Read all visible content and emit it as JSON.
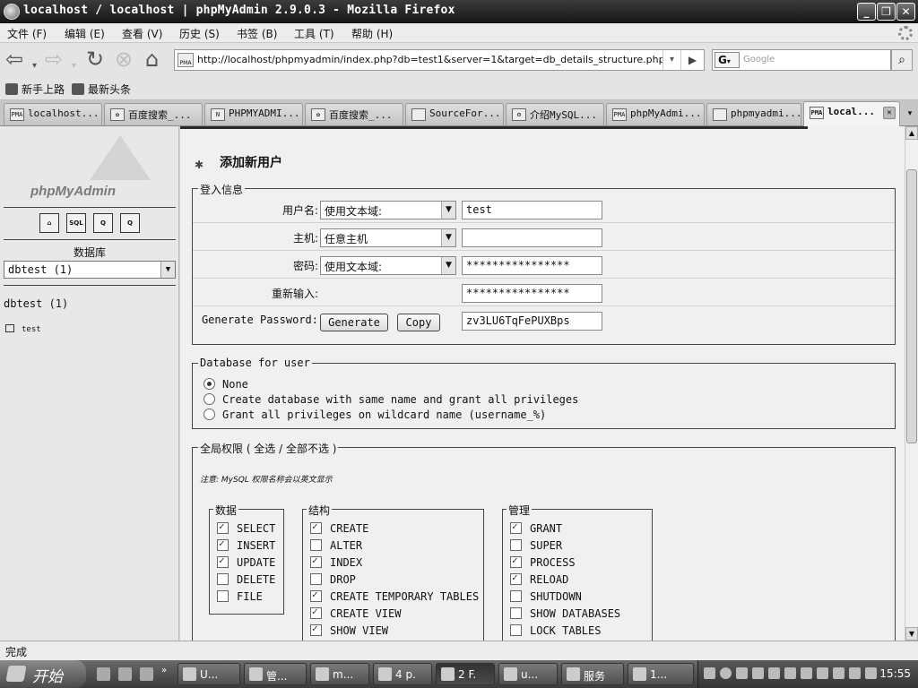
{
  "window": {
    "title": "localhost / localhost | phpMyAdmin 2.9.0.3 - Mozilla Firefox",
    "buttons": {
      "minimize": "_",
      "maximize": "❐",
      "close": "✕"
    }
  },
  "menu": [
    "文件 (F)",
    "编辑 (E)",
    "查看 (V)",
    "历史 (S)",
    "书签 (B)",
    "工具 (T)",
    "帮助 (H)"
  ],
  "nav": {
    "url": "http://localhost/phpmyadmin/index.php?db=test1&server=1&target=db_details_structure.php",
    "url_icon": "PMA",
    "search_engine": "G",
    "search_placeholder": "Google"
  },
  "bookmarks": [
    "新手上路",
    "最新头条"
  ],
  "tabs": [
    {
      "label": "localhost...",
      "icon": "PMA"
    },
    {
      "label": "百度搜索_...",
      "icon": "paw"
    },
    {
      "label": "PHPMYADMI...",
      "icon": "N"
    },
    {
      "label": "百度搜索_...",
      "icon": "paw"
    },
    {
      "label": "SourceFor...",
      "icon": "page"
    },
    {
      "label": "介绍MySQL...",
      "icon": "gears"
    },
    {
      "label": "phpMyAdmi...",
      "icon": "PMA"
    },
    {
      "label": "phpmyadmi...",
      "icon": "page"
    },
    {
      "label": "local...",
      "icon": "PMA",
      "active": true
    }
  ],
  "left": {
    "logo_text": "phpMyAdmin",
    "quick_icons": [
      "home",
      "SQL",
      "Q",
      "Q"
    ],
    "db_label": "数据库",
    "db_select": "dbtest (1)",
    "db_name": "dbtest (1)",
    "table": "test"
  },
  "main": {
    "heading": "添加新用户",
    "login": {
      "legend": "登入信息",
      "username_label": "用户名:",
      "username_select": "使用文本域:",
      "username_value": "test",
      "host_label": "主机:",
      "host_select": "任意主机",
      "host_value": "",
      "password_label": "密码:",
      "password_select": "使用文本域:",
      "password_value": "****************",
      "retype_label": "重新输入:",
      "retype_value": "****************",
      "genpw_label": "Generate Password:",
      "generate_btn": "Generate",
      "copy_btn": "Copy",
      "genpw_value": "zv3LU6TqFePUXBps"
    },
    "dbuser": {
      "legend": "Database for user",
      "options": [
        {
          "label": "None",
          "checked": true
        },
        {
          "label": "Create database with same name and grant all privileges",
          "checked": false
        },
        {
          "label": "Grant all privileges on wildcard name (username_%)",
          "checked": false
        }
      ]
    },
    "global": {
      "legend": "全局权限 ( 全选 / 全部不选 )",
      "note": "注意: MySQL 权限名称会以英文显示",
      "groups": [
        {
          "legend": "数据",
          "items": [
            {
              "label": "SELECT",
              "checked": true
            },
            {
              "label": "INSERT",
              "checked": true
            },
            {
              "label": "UPDATE",
              "checked": true
            },
            {
              "label": "DELETE",
              "checked": false
            },
            {
              "label": "FILE",
              "checked": false
            }
          ]
        },
        {
          "legend": "结构",
          "items": [
            {
              "label": "CREATE",
              "checked": true
            },
            {
              "label": "ALTER",
              "checked": false
            },
            {
              "label": "INDEX",
              "checked": true
            },
            {
              "label": "DROP",
              "checked": false
            },
            {
              "label": "CREATE TEMPORARY TABLES",
              "checked": true
            },
            {
              "label": "CREATE VIEW",
              "checked": true
            },
            {
              "label": "SHOW VIEW",
              "checked": true
            }
          ]
        },
        {
          "legend": "管理",
          "items": [
            {
              "label": "GRANT",
              "checked": true
            },
            {
              "label": "SUPER",
              "checked": false
            },
            {
              "label": "PROCESS",
              "checked": true
            },
            {
              "label": "RELOAD",
              "checked": true
            },
            {
              "label": "SHUTDOWN",
              "checked": false
            },
            {
              "label": "SHOW DATABASES",
              "checked": false
            },
            {
              "label": "LOCK TABLES",
              "checked": false
            }
          ]
        }
      ]
    }
  },
  "status": "完成",
  "taskbar": {
    "start": "开始",
    "items": [
      "U...",
      "管...",
      "m...",
      "4 p.",
      "2 F.",
      "u...",
      "服务",
      "1..."
    ],
    "clock": "15:55"
  }
}
